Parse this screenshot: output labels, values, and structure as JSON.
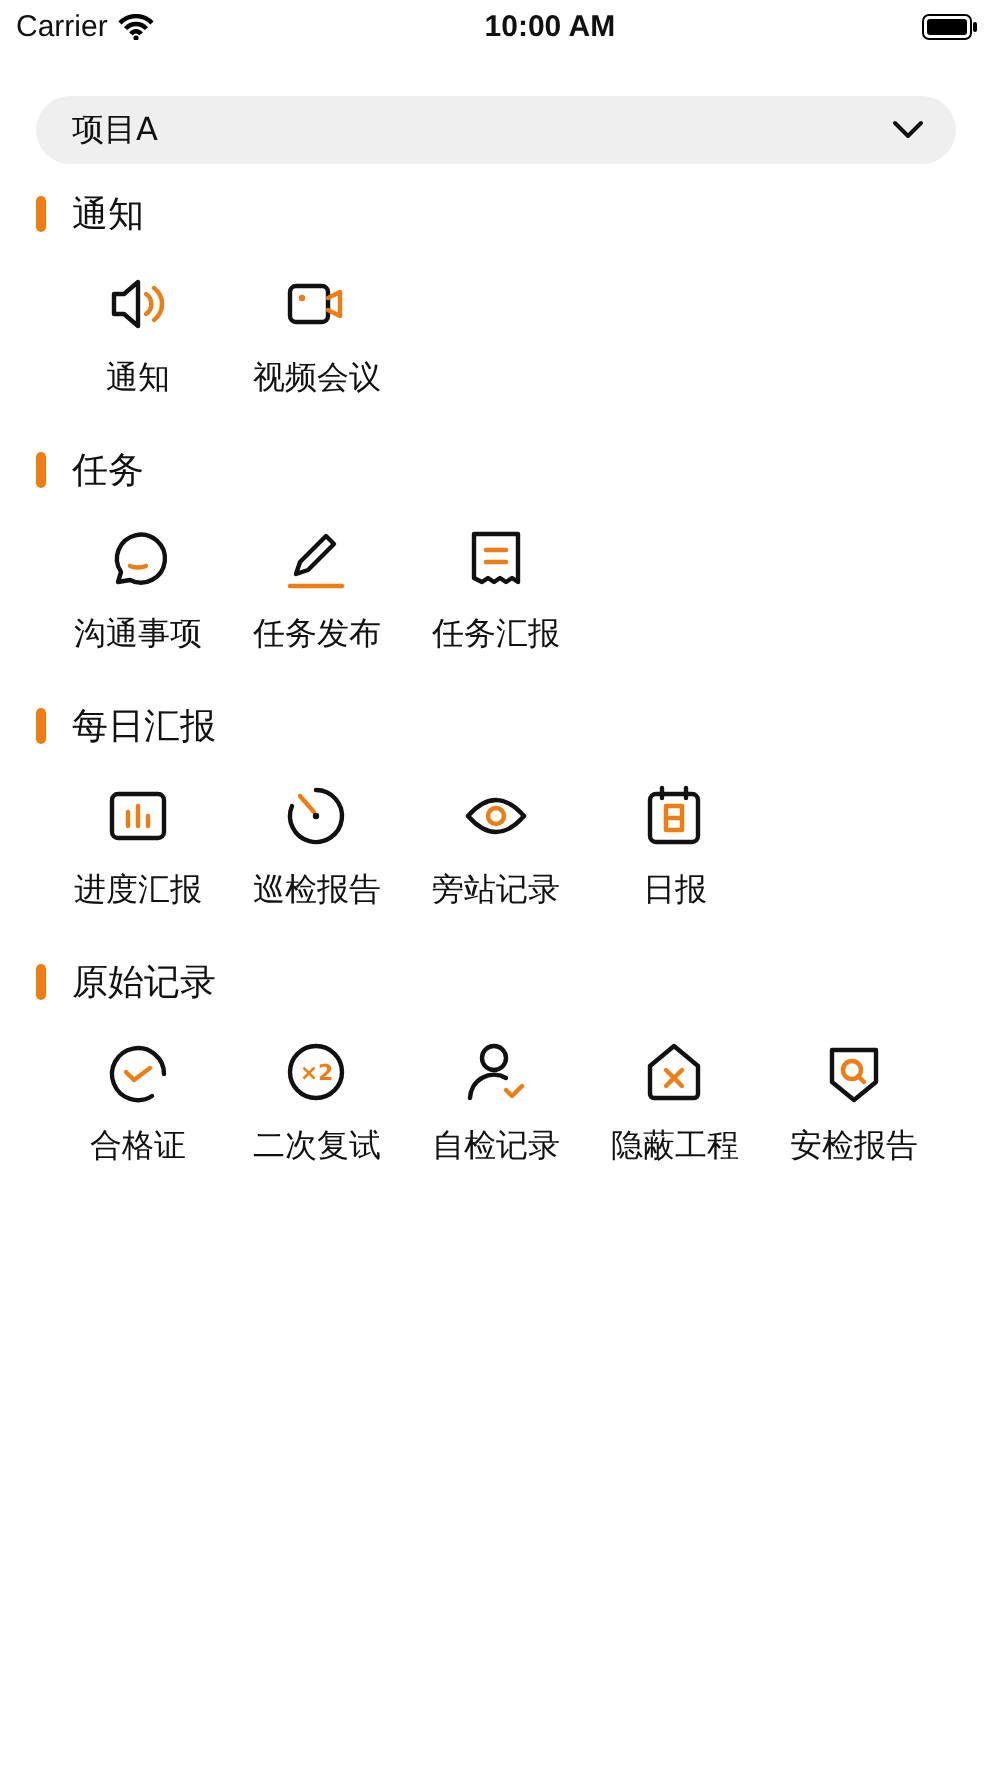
{
  "status_bar": {
    "carrier": "Carrier",
    "time": "10:00 AM"
  },
  "project_select": {
    "value": "项目A"
  },
  "sections": [
    {
      "title": "通知",
      "items": [
        {
          "label": "通知"
        },
        {
          "label": "视频会议"
        }
      ]
    },
    {
      "title": "任务",
      "items": [
        {
          "label": "沟通事项"
        },
        {
          "label": "任务发布"
        },
        {
          "label": "任务汇报"
        }
      ]
    },
    {
      "title": "每日汇报",
      "items": [
        {
          "label": "进度汇报"
        },
        {
          "label": "巡检报告"
        },
        {
          "label": "旁站记录"
        },
        {
          "label": "日报"
        }
      ]
    },
    {
      "title": "原始记录",
      "items": [
        {
          "label": "合格证"
        },
        {
          "label": "二次复试",
          "badge": "×2"
        },
        {
          "label": "自检记录"
        },
        {
          "label": "隐蔽工程"
        },
        {
          "label": "安检报告"
        }
      ]
    }
  ]
}
